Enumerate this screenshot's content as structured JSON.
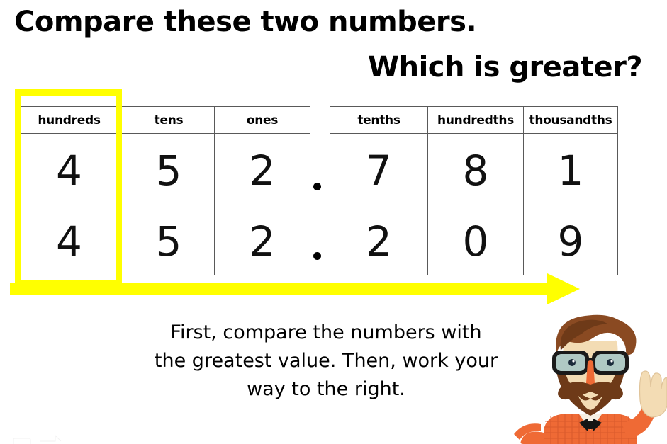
{
  "title": {
    "line_1": "Compare these two numbers.",
    "line_2": "Which is greater?"
  },
  "place_value_chart": {
    "whole_columns": [
      {
        "key": "hundreds",
        "label": "hundreds",
        "color": "#fa4b28"
      },
      {
        "key": "tens",
        "label": "tens",
        "color": "#9fd84a"
      },
      {
        "key": "ones",
        "label": "ones",
        "color": "#d824a4"
      }
    ],
    "decimal_columns": [
      {
        "key": "tenths",
        "label": "tenths",
        "color": "#fac313"
      },
      {
        "key": "hundredths",
        "label": "hundredths",
        "color": "#f9514f"
      },
      {
        "key": "thousandths",
        "label": "thousandths",
        "color": "#2889a8"
      }
    ],
    "rows": [
      {
        "name": "number-1",
        "whole_digits": [
          "4",
          "5",
          "2"
        ],
        "decimal_separator": ".",
        "decimal_digits": [
          "7",
          "8",
          "1"
        ],
        "value": "452.781"
      },
      {
        "name": "number-2",
        "whole_digits": [
          "4",
          "5",
          "2"
        ],
        "decimal_separator": ".",
        "decimal_digits": [
          "2",
          "0",
          "9"
        ],
        "value": "452.209"
      }
    ],
    "highlight": {
      "column": "hundreds",
      "color": "#ffff00"
    },
    "arrow": {
      "direction": "right",
      "color": "#ffff00"
    }
  },
  "caption": {
    "line_1": "First, compare the numbers with",
    "line_2": "the greatest value. Then, work your",
    "line_3": "way to the right."
  },
  "mascot": {
    "name": "hipster-teacher-waving",
    "hair_color": "#8a4a22",
    "skin_color": "#f3dcb4",
    "shirt_color": "#ef6a35",
    "glasses_color": "#1a1a1a",
    "nose_color": "#ef6a35"
  }
}
